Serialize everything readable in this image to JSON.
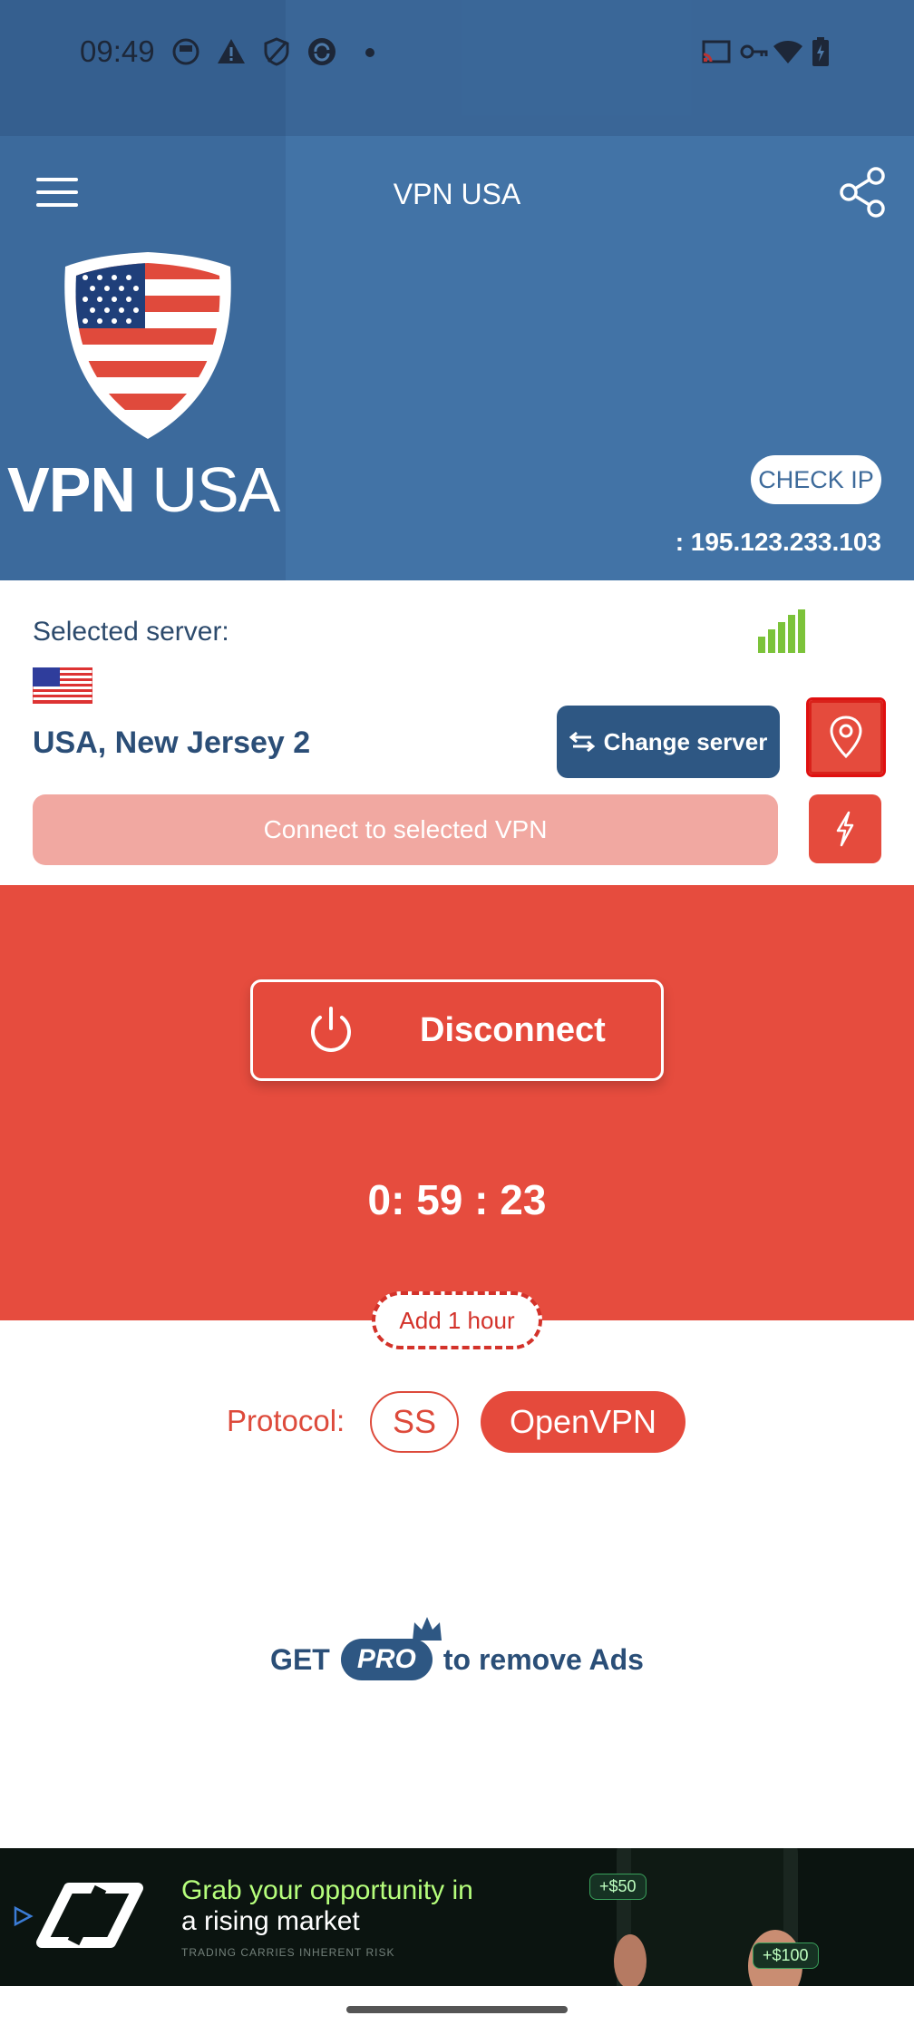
{
  "status_bar": {
    "time": "09:49"
  },
  "header": {
    "title": "VPN USA",
    "brand_bold": "VPN",
    "brand_light": "USA",
    "check_ip_label": "CHECK IP",
    "ip_text": ": 195.123.233.103"
  },
  "server": {
    "selected_label": "Selected server:",
    "name": "USA, New Jersey 2",
    "change_label": "Change server",
    "connect_label": "Connect to selected VPN"
  },
  "vpn": {
    "disconnect_label": "Disconnect",
    "timer": "0: 59 : 23",
    "add_hour_label": "Add 1 hour"
  },
  "protocol": {
    "label": "Protocol:",
    "options": [
      "SS",
      "OpenVPN"
    ],
    "selected": "OpenVPN"
  },
  "promo": {
    "get": "GET",
    "pro": "PRO",
    "suffix": "to remove Ads"
  },
  "ad": {
    "line1": "Grab your opportunity in",
    "line2": "a rising market",
    "disclaimer": "TRADING CARRIES INHERENT RISK",
    "chip1": "+$50",
    "chip2": "+$100"
  },
  "colors": {
    "header_blue": "#4273a6",
    "navy": "#2e5783",
    "red": "#e64c3e",
    "signal_green": "#7cc33a"
  }
}
